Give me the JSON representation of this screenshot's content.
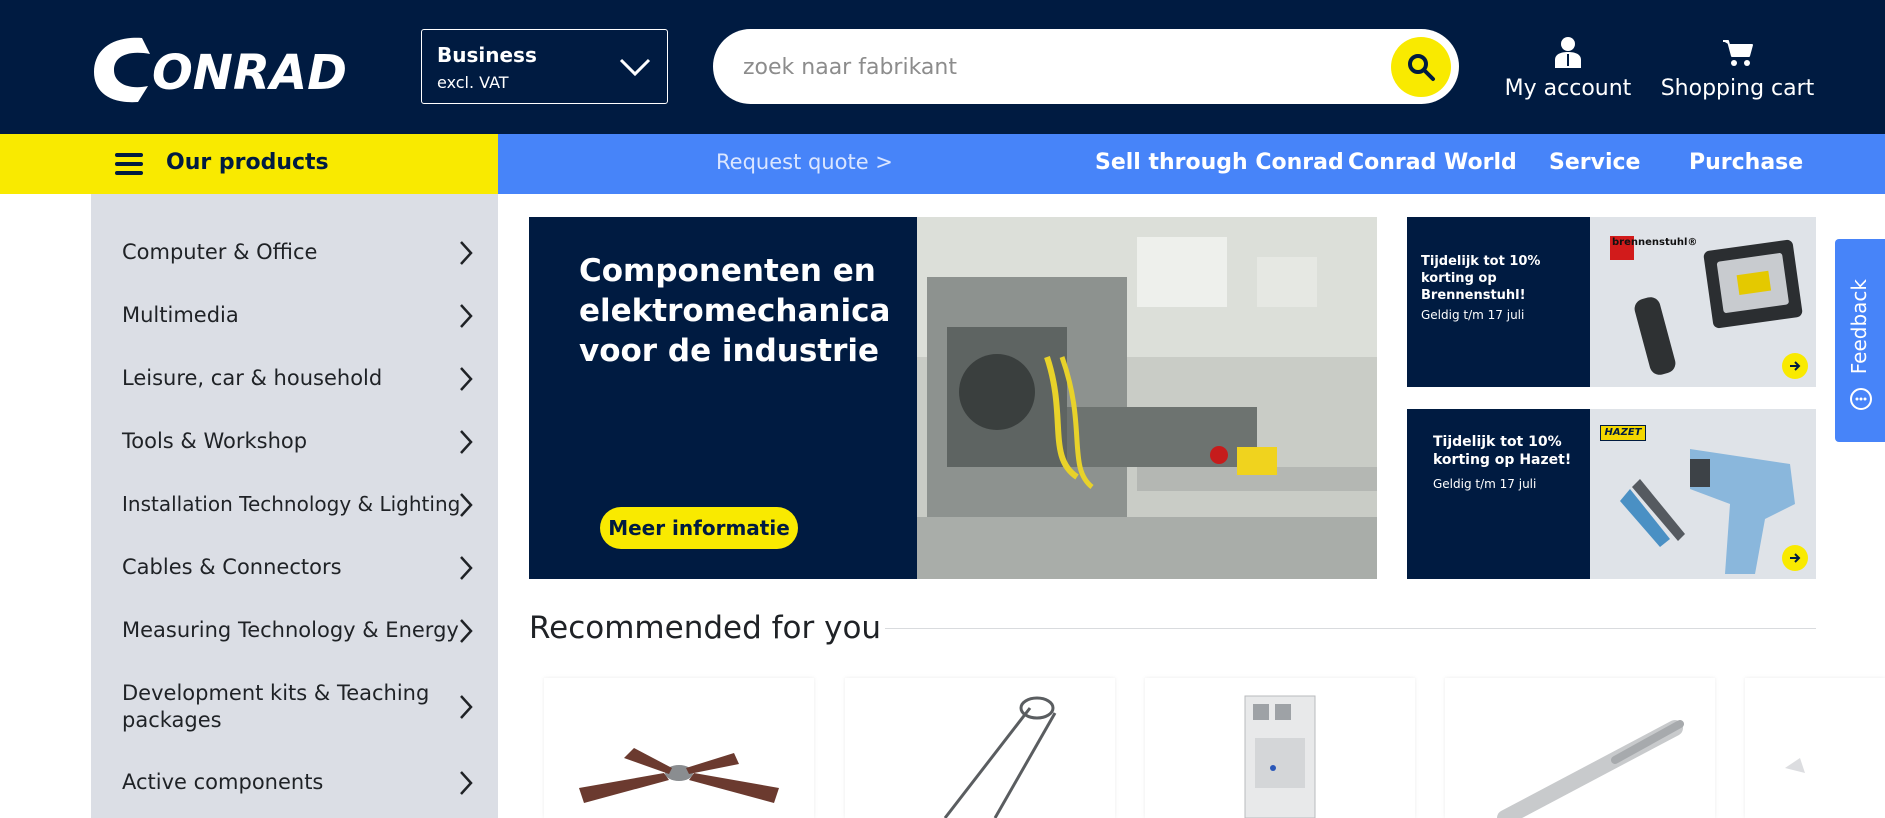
{
  "header": {
    "logo_text": "CONRAD",
    "business": {
      "title": "Business",
      "subtitle": "excl. VAT"
    },
    "search": {
      "placeholder": "zoek naar fabrikant",
      "value": ""
    },
    "account_label": "My account",
    "cart_label": "Shopping cart"
  },
  "nav": {
    "products_label": "Our products",
    "request_quote": "Request quote >",
    "links": [
      "Sell through Conrad",
      "Conrad World",
      "Service",
      "Purchase"
    ]
  },
  "sidebar": {
    "categories": [
      "Computer & Office",
      "Multimedia",
      "Leisure, car & household",
      "Tools & Workshop",
      "Installation Technology & Lighting",
      "Cables & Connectors",
      "Measuring Technology & Energy",
      "Development kits & Teaching",
      "packages",
      "Active components"
    ]
  },
  "hero": {
    "title": "Componenten en elektromechanica voor de industrie",
    "button": "Meer informatie"
  },
  "promos": [
    {
      "title": "Tijdelijk tot 10% korting op Brennenstuhl!",
      "validity": "Geldig t/m 17 juli",
      "brand": "brennenstuhl®"
    },
    {
      "title": "Tijdelijk tot 10% korting op Hazet!",
      "validity": "Geldig t/m 17 juli",
      "brand": "HAZET"
    }
  ],
  "feedback_label": "Feedback",
  "recommended": {
    "title": "Recommended for you"
  },
  "colors": {
    "navy": "#001b41",
    "yellow": "#f9ea00",
    "blue": "#4784f9",
    "sidebar": "#dbdee5"
  }
}
